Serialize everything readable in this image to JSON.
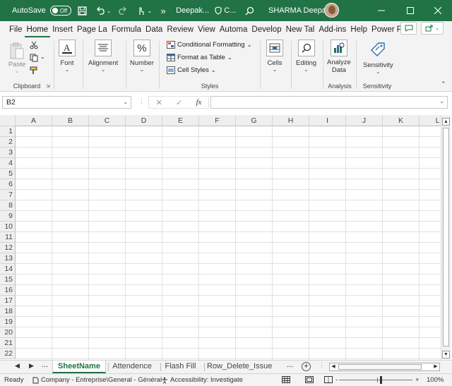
{
  "titlebar": {
    "autosave_label": "AutoSave",
    "autosave_state": "Off",
    "doc_name": "Deepak...",
    "sensitivity": "C...",
    "user_name": "SHARMA Deepak",
    "more": "»"
  },
  "ribbon_tabs": [
    "File",
    "Home",
    "Insert",
    "Page La",
    "Formula",
    "Data",
    "Review",
    "View",
    "Automa",
    "Develop",
    "New Tal",
    "Add-ins",
    "Help",
    "Power P"
  ],
  "active_tab": "Home",
  "ribbon": {
    "clipboard": {
      "label": "Clipboard",
      "paste": "Paste"
    },
    "font": {
      "label": "Font"
    },
    "alignment": {
      "label": "Alignment"
    },
    "number": {
      "label": "Number",
      "symbol": "%"
    },
    "styles": {
      "label": "Styles",
      "conditional": "Conditional Formatting",
      "format_table": "Format as Table",
      "cell_styles": "Cell Styles"
    },
    "cells": {
      "label": "Cells"
    },
    "editing": {
      "label": "Editing"
    },
    "analysis": {
      "label": "Analysis",
      "analyze_line1": "Analyze",
      "analyze_line2": "Data"
    },
    "sensitivity": {
      "label": "Sensitivity",
      "button": "Sensitivity"
    }
  },
  "formula_bar": {
    "name_box": "B2",
    "fx": "fx",
    "value": ""
  },
  "columns": [
    "A",
    "B",
    "C",
    "D",
    "E",
    "F",
    "G",
    "H",
    "I",
    "J",
    "K",
    "L"
  ],
  "rows": [
    "1",
    "2",
    "3",
    "4",
    "5",
    "6",
    "7",
    "8",
    "9",
    "10",
    "11",
    "12",
    "13",
    "14",
    "15",
    "16",
    "17",
    "18",
    "19",
    "20",
    "21",
    "22"
  ],
  "sheets": {
    "tabs": [
      "SheetName",
      "Attendence",
      "Flash Fill",
      "Row_Delete_Issue"
    ],
    "active": "SheetName",
    "ellipsis": "..."
  },
  "status": {
    "ready": "Ready",
    "label": "Company - Entreprise\\General - Général",
    "accessibility": "Accessibility: Investigate",
    "zoom": "100%",
    "zoom_minus": "-",
    "zoom_plus": "+"
  },
  "colors": {
    "accent": "#217346",
    "titlebar": "#217346"
  }
}
